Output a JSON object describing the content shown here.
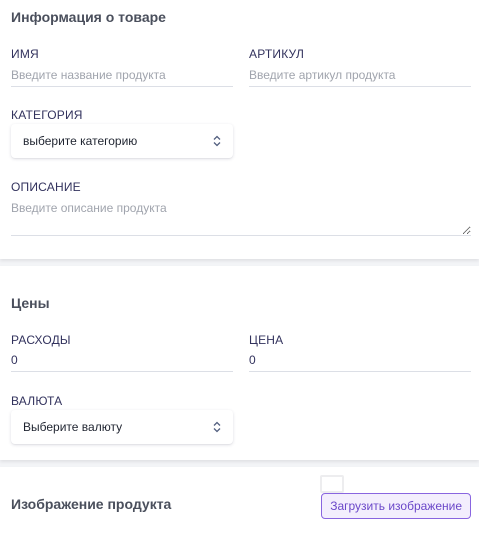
{
  "product_info": {
    "title": "Информация о товаре",
    "name_label": "ИМЯ",
    "name_placeholder": "Введите название продукта",
    "sku_label": "АРТИКУЛ",
    "sku_placeholder": "Введите артикул продукта",
    "category_label": "КАТЕГОРИЯ",
    "category_value": "выберите категорию",
    "description_label": "ОПИСАНИЕ",
    "description_placeholder": "Введите описание продукта"
  },
  "prices": {
    "title": "Цены",
    "expenses_label": "РАСХОДЫ",
    "expenses_value": "0",
    "price_label": "ЦЕНА",
    "price_value": "0",
    "currency_label": "ВАЛЮТА",
    "currency_value": "Выберите валюту"
  },
  "product_image": {
    "title": "Изображение продукта",
    "upload_label": "Загрузить изображение"
  },
  "icons": {
    "select_arrows": "updown-chevron-icon"
  },
  "colors": {
    "accent": "#8965e0",
    "background": "#f3f4f7",
    "card": "#ffffff"
  }
}
